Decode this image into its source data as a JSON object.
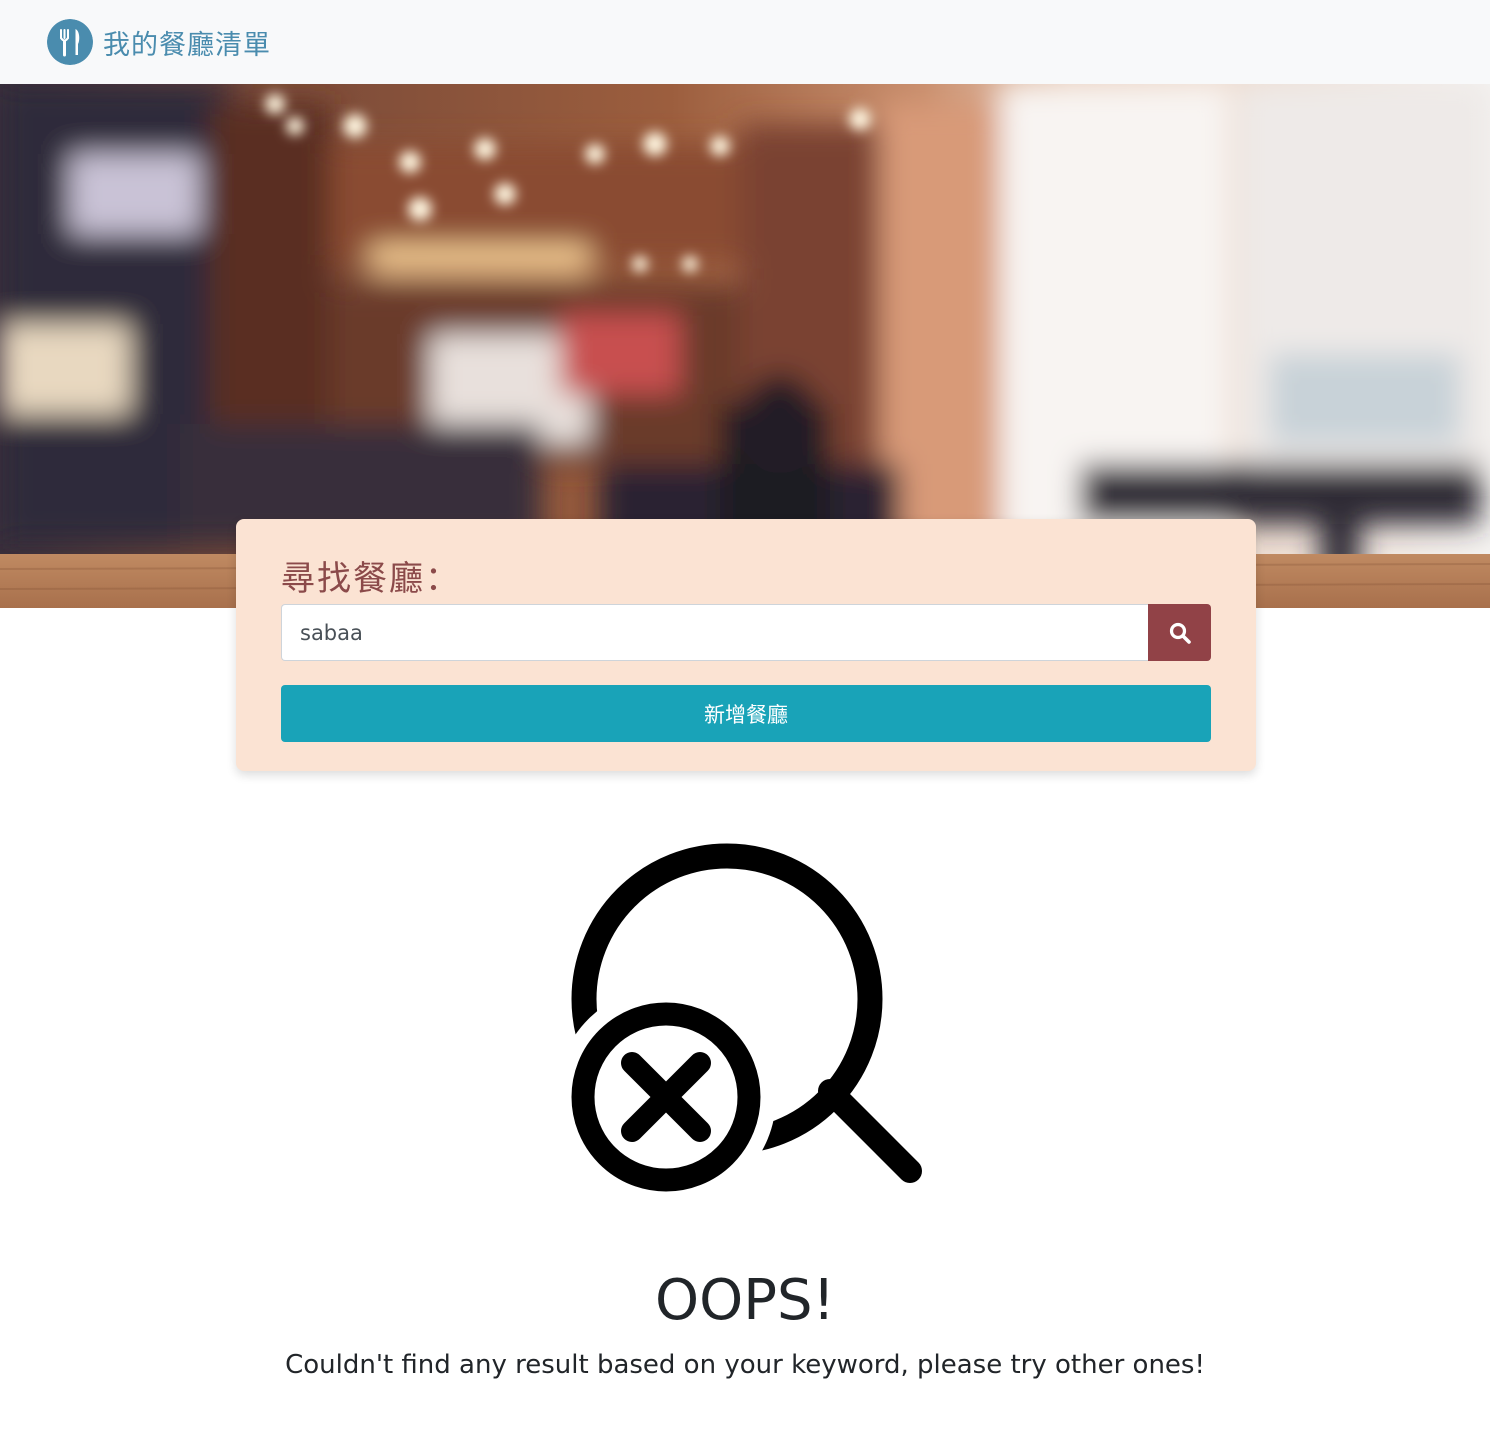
{
  "navbar": {
    "brand_text": "我的餐廳清單",
    "brand_icon": "utensils-icon",
    "brand_color": "#4a8cae",
    "background": "#f8f9fa"
  },
  "banner": {
    "image": "blurred-restaurant-interior"
  },
  "search": {
    "title": "尋找餐廳：",
    "input_value": "sabaa",
    "search_icon": "search-icon",
    "search_button_color": "#914247",
    "card_background": "#fbe3d3",
    "add_button_label": "新增餐廳",
    "add_button_color": "#19a3b8"
  },
  "not_found": {
    "icon": "search-no-result-icon",
    "title": "OOPS!",
    "message": "Couldn't find any result based on your keyword, please try other ones!"
  }
}
